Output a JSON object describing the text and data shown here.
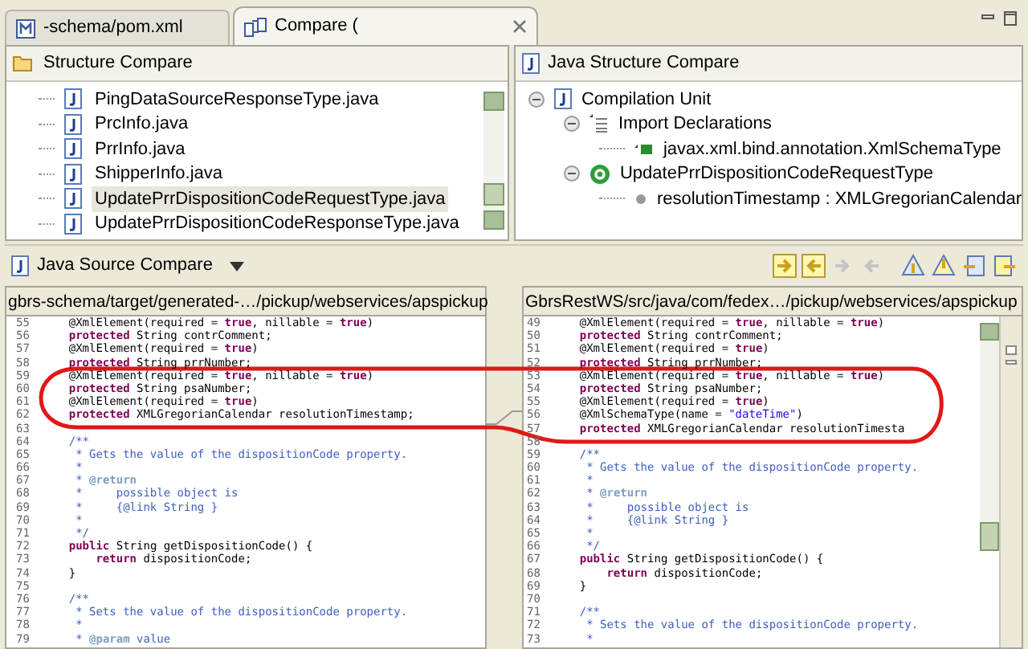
{
  "tabs": [
    {
      "label": "-schema/pom.xml",
      "kind": "maven",
      "selected": false
    },
    {
      "label": "Compare (",
      "kind": "compare",
      "selected": true
    }
  ],
  "structure_compare": {
    "title": "Structure Compare",
    "items": [
      {
        "label": "PingDataSourceResponseType.java",
        "selected": false
      },
      {
        "label": "PrcInfo.java",
        "selected": false
      },
      {
        "label": "PrrInfo.java",
        "selected": false
      },
      {
        "label": "ShipperInfo.java",
        "selected": false
      },
      {
        "label": "UpdatePrrDispositionCodeRequestType.java",
        "selected": true
      },
      {
        "label": "UpdatePrrDispositionCodeResponseType.java",
        "selected": false
      }
    ]
  },
  "java_structure_compare": {
    "title": "Java Structure Compare",
    "tree": [
      {
        "label": "Compilation Unit",
        "kind": "unit",
        "expanded": true,
        "children": [
          {
            "label": "Import Declarations",
            "kind": "imports",
            "expanded": true,
            "children": [
              {
                "label": "javax.xml.bind.annotation.XmlSchemaType",
                "kind": "import"
              }
            ]
          },
          {
            "label": "UpdatePrrDispositionCodeRequestType",
            "kind": "class",
            "expanded": true,
            "children": [
              {
                "label": "resolutionTimestamp : XMLGregorianCalendar",
                "kind": "field"
              }
            ]
          }
        ]
      }
    ]
  },
  "source_compare": {
    "title": "Java Source Compare",
    "left": {
      "path": "gbrs-schema/target/generated-…/pickup/webservices/apspickup",
      "lines": [
        {
          "number": "55",
          "kind": "code",
          "text": "    @XmlElement(required = **true**, nillable = **true**)"
        },
        {
          "number": "56",
          "kind": "code",
          "text": "    **protected** String contrComment;"
        },
        {
          "number": "57",
          "kind": "code",
          "text": "    @XmlElement(required = **true**)"
        },
        {
          "number": "58",
          "kind": "code",
          "text": "    **protected** String prrNumber;"
        },
        {
          "number": "59",
          "kind": "code",
          "text": "    @XmlElement(required = **true**, nillable = **true**)"
        },
        {
          "number": "60",
          "kind": "code",
          "text": "    **protected** String psaNumber;"
        },
        {
          "number": "61",
          "kind": "code",
          "text": "    @XmlElement(required = **true**)"
        },
        {
          "number": "62",
          "kind": "code",
          "text": "    **protected** XMLGregorianCalendar resolutionTimestamp;"
        },
        {
          "number": "63"
        },
        {
          "number": "64",
          "kind": "comment",
          "text": "    /**"
        },
        {
          "number": "65",
          "kind": "comment",
          "text": "     * Gets the value of the dispositionCode property."
        },
        {
          "number": "66",
          "kind": "comment",
          "text": "     *"
        },
        {
          "number": "67",
          "kind": "comment",
          "text": "     * **@return**"
        },
        {
          "number": "68",
          "kind": "comment",
          "text": "     *     possible object is"
        },
        {
          "number": "69",
          "kind": "comment",
          "text": "     *     {@link String }"
        },
        {
          "number": "70",
          "kind": "comment",
          "text": "     *"
        },
        {
          "number": "71",
          "kind": "comment",
          "text": "     */"
        },
        {
          "number": "72",
          "kind": "code",
          "text": "    **public** String getDispositionCode() {"
        },
        {
          "number": "73",
          "kind": "code",
          "text": "        **return** dispositionCode;"
        },
        {
          "number": "74",
          "kind": "code",
          "text": "    }"
        },
        {
          "number": "75"
        },
        {
          "number": "76",
          "kind": "comment",
          "text": "    /**"
        },
        {
          "number": "77",
          "kind": "comment",
          "text": "     * Sets the value of the dispositionCode property."
        },
        {
          "number": "78",
          "kind": "comment",
          "text": "     *"
        },
        {
          "number": "79",
          "kind": "comment",
          "text": "     * **@param** value"
        }
      ]
    },
    "right": {
      "path": "GbrsRestWS/src/java/com/fedex…/pickup/webservices/apspickup",
      "lines": [
        {
          "number": "49",
          "kind": "code",
          "text": "    @XmlElement(required = **true**, nillable = **true**)"
        },
        {
          "number": "50",
          "kind": "code",
          "text": "    **protected** String contrComment;"
        },
        {
          "number": "51",
          "kind": "code",
          "text": "    @XmlElement(required = **true**)"
        },
        {
          "number": "52",
          "kind": "code",
          "text": "    **protected** String prrNumber;"
        },
        {
          "number": "53",
          "kind": "code",
          "text": "    @XmlElement(required = **true**, nillable = **true**)"
        },
        {
          "number": "54",
          "kind": "code",
          "text": "    **protected** String psaNumber;"
        },
        {
          "number": "55",
          "kind": "code",
          "text": "    @XmlElement(required = **true**)"
        },
        {
          "number": "56",
          "kind": "code",
          "text": "    @XmlSchemaType(name = *\"dateTime\"*)"
        },
        {
          "number": "57",
          "kind": "code",
          "text": "    **protected** XMLGregorianCalendar resolutionTimesta"
        },
        {
          "number": "58"
        },
        {
          "number": "59",
          "kind": "comment",
          "text": "    /**"
        },
        {
          "number": "60",
          "kind": "comment",
          "text": "     * Gets the value of the dispositionCode property."
        },
        {
          "number": "61",
          "kind": "comment",
          "text": "     *"
        },
        {
          "number": "62",
          "kind": "comment",
          "text": "     * **@return**"
        },
        {
          "number": "63",
          "kind": "comment",
          "text": "     *     possible object is"
        },
        {
          "number": "64",
          "kind": "comment",
          "text": "     *     {@link String }"
        },
        {
          "number": "65",
          "kind": "comment",
          "text": "     *"
        },
        {
          "number": "66",
          "kind": "comment",
          "text": "     */"
        },
        {
          "number": "67",
          "kind": "code",
          "text": "    **public** String getDispositionCode() {"
        },
        {
          "number": "68",
          "kind": "code",
          "text": "        **return** dispositionCode;"
        },
        {
          "number": "69",
          "kind": "code",
          "text": "    }"
        },
        {
          "number": "70"
        },
        {
          "number": "71",
          "kind": "comment",
          "text": "    /**"
        },
        {
          "number": "72",
          "kind": "comment",
          "text": "     * Sets the value of the dispositionCode property."
        },
        {
          "number": "73",
          "kind": "comment",
          "text": "     *"
        }
      ]
    }
  }
}
